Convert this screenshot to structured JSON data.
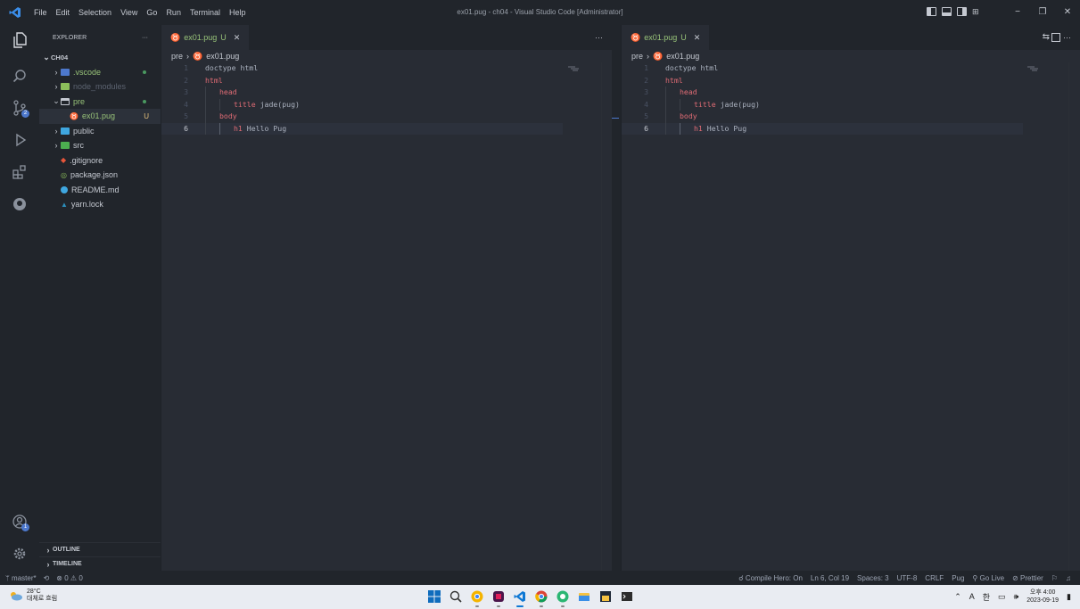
{
  "window": {
    "title": "ex01.pug - ch04 - Visual Studio Code [Administrator]",
    "menu": [
      "File",
      "Edit",
      "Selection",
      "View",
      "Go",
      "Run",
      "Terminal",
      "Help"
    ],
    "controls": {
      "minimize": "−",
      "restore": "❐",
      "close": "✕"
    }
  },
  "sidebar": {
    "header": "EXPLORER",
    "more": "···",
    "root": "CH04",
    "items": [
      {
        "label": ".vscode",
        "kind": "folder",
        "color": "#4d78cc",
        "textColor": "#98c379",
        "dot": true,
        "chevron": "›"
      },
      {
        "label": "node_modules",
        "kind": "folder",
        "color": "#8cbf5b",
        "textColor": "#5c6370",
        "chevron": "›"
      },
      {
        "label": "pre",
        "kind": "folder-open",
        "color": "#c5c9d1",
        "textColor": "#98c379",
        "dot": true,
        "chevron": "⌄"
      },
      {
        "label": "ex01.pug",
        "kind": "pug",
        "textColor": "#98c379",
        "badge": "U",
        "selected": true
      },
      {
        "label": "public",
        "kind": "folder",
        "color": "#3fa7e0",
        "textColor": "#c5c9d1",
        "chevron": "›"
      },
      {
        "label": "src",
        "kind": "folder",
        "color": "#4caf50",
        "textColor": "#c5c9d1",
        "chevron": "›"
      },
      {
        "label": ".gitignore",
        "kind": "git",
        "textColor": "#c5c9d1"
      },
      {
        "label": "package.json",
        "kind": "npm",
        "textColor": "#c5c9d1"
      },
      {
        "label": "README.md",
        "kind": "info",
        "textColor": "#c5c9d1"
      },
      {
        "label": "yarn.lock",
        "kind": "yarn",
        "textColor": "#c5c9d1"
      }
    ],
    "sections": [
      "OUTLINE",
      "TIMELINE"
    ]
  },
  "activity": {
    "icons": [
      "explorer-icon",
      "search-icon",
      "source-control-icon",
      "run-debug-icon",
      "extensions-icon",
      "github-icon"
    ],
    "scm_badge": "2",
    "account_badge": "1"
  },
  "editor_left": {
    "tab": {
      "label": "ex01.pug",
      "status": "U",
      "close": "✕"
    },
    "more": "···",
    "breadcrumb": [
      "pre",
      "ex01.pug"
    ]
  },
  "editor_right": {
    "tab": {
      "label": "ex01.pug",
      "status": "U",
      "close": "✕"
    },
    "more": "···",
    "breadcrumb": [
      "pre",
      "ex01.pug"
    ]
  },
  "code": [
    {
      "n": "1",
      "indent": 0,
      "tag": "doctype",
      "text": " html",
      "tagPlain": true
    },
    {
      "n": "2",
      "indent": 0,
      "tag": "html",
      "text": ""
    },
    {
      "n": "3",
      "indent": 1,
      "tag": "head",
      "text": ""
    },
    {
      "n": "4",
      "indent": 2,
      "tag": "title",
      "text": " jade(pug)"
    },
    {
      "n": "5",
      "indent": 1,
      "tag": "body",
      "text": ""
    },
    {
      "n": "6",
      "indent": 2,
      "tag": "h1",
      "text": " Hello Pug",
      "current": true
    }
  ],
  "status": {
    "branch": "master*",
    "errors": "0",
    "warnings": "0",
    "right": [
      "Compile Hero: On",
      "Ln 6, Col 19",
      "Spaces: 3",
      "UTF-8",
      "CRLF",
      "Pug",
      "Go Live",
      "Prettier"
    ]
  },
  "taskbar": {
    "temp": "28°C",
    "weather": "대체로 흐림",
    "ime1": "A",
    "ime2": "한",
    "time": "오후 4:00",
    "date": "2023-09-19"
  }
}
